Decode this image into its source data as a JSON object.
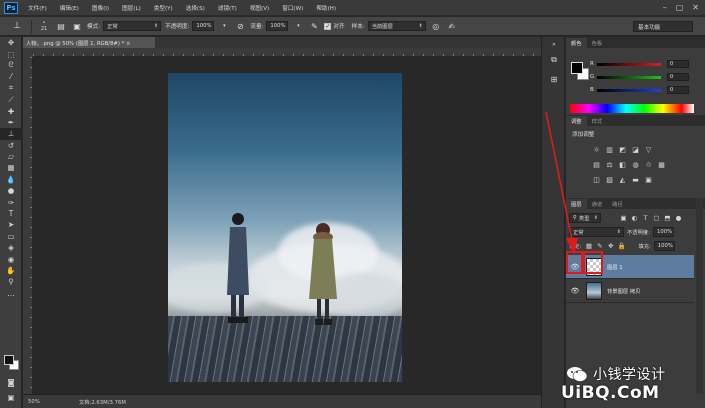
{
  "app": {
    "logo": "Ps"
  },
  "menubar": {
    "items": [
      "文件(F)",
      "编辑(E)",
      "图像(I)",
      "图层(L)",
      "类型(Y)",
      "选择(S)",
      "滤镜(T)",
      "视图(V)",
      "窗口(W)",
      "帮助(H)"
    ],
    "window_controls": [
      "–",
      "▢",
      "✕"
    ]
  },
  "options_bar": {
    "brush_size": "21",
    "mode_label": "模式:",
    "mode_value": "正常",
    "opacity_label": "不透明度:",
    "opacity_value": "100%",
    "flow_label": "流量:",
    "flow_value": "100%",
    "aligned_label": "对齐",
    "sample_label": "样本:",
    "sample_value": "当前图层",
    "workspace": "基本功能"
  },
  "document": {
    "tab_title": "人物。.png @ 50% (图层 1, RGB/8#) * ×",
    "zoom": "50%",
    "doc_size": "文档:2.63M/3.76M"
  },
  "color_panel": {
    "tabs": [
      "颜色",
      "色板"
    ],
    "rows": [
      {
        "label": "R",
        "value": "0",
        "color": "#d42020"
      },
      {
        "label": "G",
        "value": "0",
        "color": "#20c020"
      },
      {
        "label": "B",
        "value": "0",
        "color": "#2040e0"
      }
    ]
  },
  "adjustments_panel": {
    "tabs": [
      "调整",
      "样式"
    ],
    "title": "添加调整"
  },
  "layers_panel": {
    "tabs": [
      "图层",
      "通道",
      "路径"
    ],
    "filter_value": "类型",
    "blend_value": "正常",
    "opacity_label": "不透明度:",
    "opacity_value": "100%",
    "lock_label": "锁定:",
    "fill_label": "填充:",
    "fill_value": "100%",
    "layers": [
      {
        "name": "图层 1",
        "selected": true
      },
      {
        "name": "背景图层 拷贝",
        "selected": false
      }
    ]
  },
  "watermark": {
    "line1": "小钱学设计",
    "line2": "UiBQ.CoM"
  },
  "accent": "#e01919"
}
